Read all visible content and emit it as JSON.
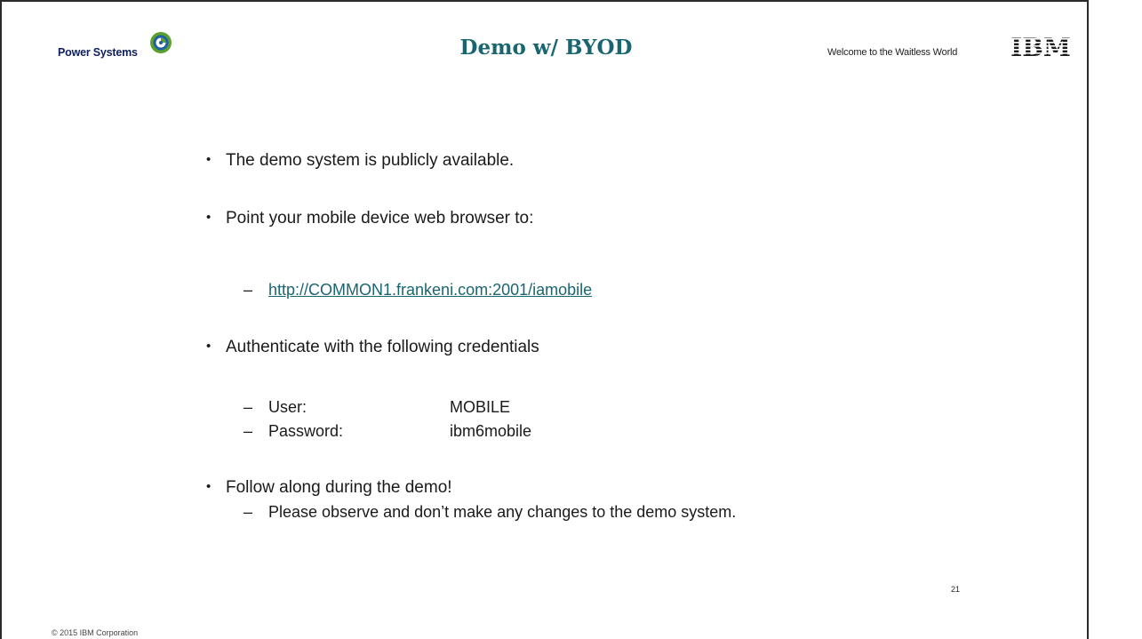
{
  "header": {
    "brand_text": "Power Systems",
    "brand_logo_icon": "power-systems-globe-icon",
    "title": "Demo w/ BYOD",
    "tagline": "Welcome to the Waitless World",
    "corporate_logo": "ibm-striped-logo",
    "corporate_logo_text": "IBM"
  },
  "colors": {
    "title": "#1a6670",
    "link": "#1a6670",
    "brand_text": "#0e1f5c",
    "logo_green": "#5aa02c",
    "logo_blue": "#1f5fa8"
  },
  "bullets": [
    {
      "text": "The demo system is publicly available."
    },
    {
      "text": "Point your mobile device web browser to:"
    },
    {
      "text": "Authenticate with the following credentials"
    },
    {
      "text": "Follow along during the demo!"
    }
  ],
  "link": {
    "text": "http://COMMON1.frankeni.com:2001/iamobile"
  },
  "credentials": {
    "user_label": "User:",
    "user_value": "MOBILE",
    "password_label": "Password:",
    "password_value": "ibm6mobile"
  },
  "note": {
    "text": "Please observe and don’t make any changes to the demo system."
  },
  "bullet_glyph": "•",
  "dash_glyph": "–",
  "footer": {
    "page_number": "21",
    "copyright": "© 2015 IBM Corporation"
  }
}
